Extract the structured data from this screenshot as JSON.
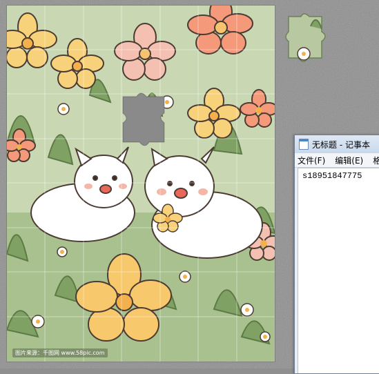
{
  "watermark": "图片来源：千图网 www.58pic.com",
  "notepad": {
    "title": "无标题 - 记事本",
    "menus": [
      "文件(F)",
      "编辑(E)",
      "格"
    ],
    "content": "s18951847775"
  },
  "colors": {
    "background": "#8f8f8f",
    "board_bg": "#c7d6b0",
    "flower_orange": "#f4997a",
    "flower_yellow": "#f8d27a",
    "flower_pink": "#f3c0b1",
    "puppy": "#ffffff"
  },
  "icons": [
    "notepad-icon"
  ]
}
